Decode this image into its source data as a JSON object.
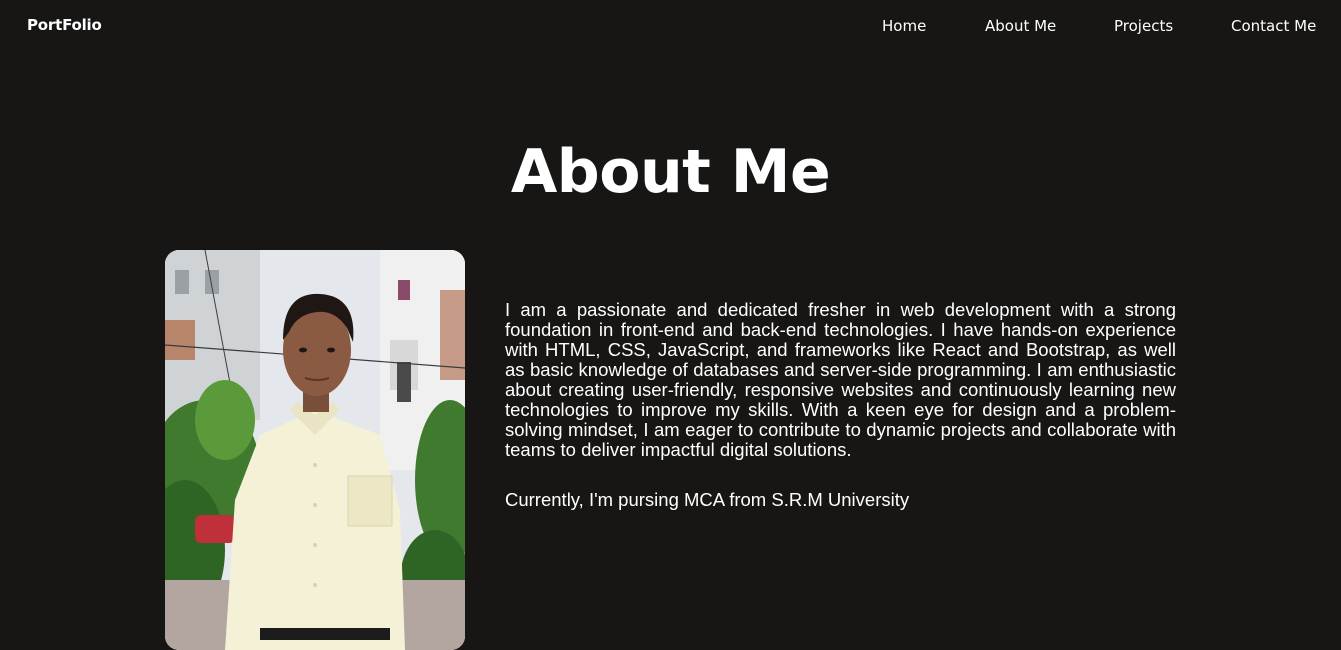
{
  "nav": {
    "brand": "PortFolio",
    "links": [
      "Home",
      "About Me",
      "Projects",
      "Contact Me"
    ]
  },
  "about": {
    "title": "About Me",
    "paragraph": "I am a passionate and dedicated fresher in web development with a strong foundation in front-end and back-end technologies. I have hands-on experience with HTML, CSS, JavaScript, and frameworks like React and Bootstrap, as well as basic knowledge of databases and server-side programming. I am enthusiastic about creating user-friendly, responsive websites and continuously learning new technologies to improve my skills. With a keen eye for design and a problem-solving mindset, I am eager to contribute to dynamic projects and collaborate with teams to deliver impactful digital solutions.",
    "currently": "Currently, I'm pursing MCA from S.R.M University"
  },
  "colors": {
    "background": "#171615",
    "text": "#ffffff"
  }
}
